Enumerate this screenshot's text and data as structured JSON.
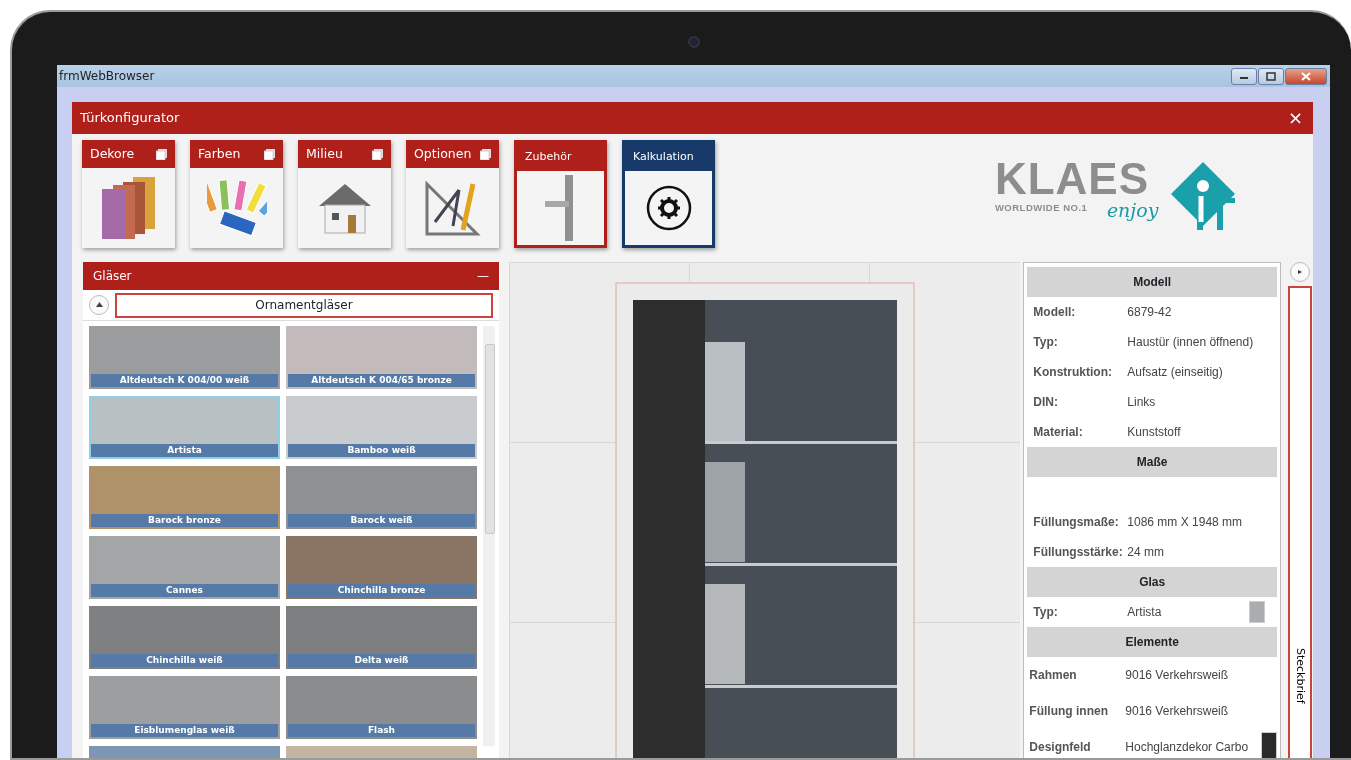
{
  "window": {
    "title": "frmWebBrowser"
  },
  "dialog": {
    "title": "Türkonfigurator",
    "close": "×"
  },
  "tiles": [
    {
      "label": "Dekore",
      "kind": "module",
      "has_menu": true,
      "selected": false
    },
    {
      "label": "Farben",
      "kind": "module",
      "has_menu": true,
      "selected": false
    },
    {
      "label": "Milieu",
      "kind": "module",
      "has_menu": true,
      "selected": false
    },
    {
      "label": "Optionen",
      "kind": "module",
      "has_menu": true,
      "selected": false
    },
    {
      "label": "Zubehör",
      "kind": "module",
      "has_menu": false,
      "selected": true
    },
    {
      "label": "Kalkulation",
      "kind": "calculation",
      "has_menu": false,
      "selected": false
    }
  ],
  "logo": {
    "name": "KLAES",
    "tagline": "WORLDWIDE NO.1",
    "slogan": "enjoy"
  },
  "glass_panel": {
    "title": "Gläser",
    "collapse": "—",
    "category": "Ornamentgläser",
    "items": [
      {
        "label": "Altdeutsch K 004/00 weiß",
        "color": "#9a9c9e",
        "selected": false
      },
      {
        "label": "Altdeutsch K 004/65 bronze",
        "color": "#c2babb",
        "selected": false
      },
      {
        "label": "Artista",
        "color": "#b9c0c4",
        "selected": true
      },
      {
        "label": "Bamboo weiß",
        "color": "#c8cccf",
        "selected": false
      },
      {
        "label": "Barock bronze",
        "color": "#b0926a",
        "selected": false
      },
      {
        "label": "Barock weiß",
        "color": "#8e9092",
        "selected": false
      },
      {
        "label": "Cannes",
        "color": "#a3a5a7",
        "selected": false
      },
      {
        "label": "Chinchilla bronze",
        "color": "#8a7464",
        "selected": false
      },
      {
        "label": "Chinchilla weiß",
        "color": "#7e8082",
        "selected": false
      },
      {
        "label": "Delta weiß",
        "color": "#7c7e80",
        "selected": false
      },
      {
        "label": "Eisblumenglas weiß",
        "color": "#9c9ea0",
        "selected": false
      },
      {
        "label": "Flash",
        "color": "#8a8c8e",
        "selected": false
      },
      {
        "color": "#7d96b4",
        "selected": false
      },
      {
        "color": "#c4b5a2",
        "selected": false
      }
    ]
  },
  "info_panel": {
    "tab": "Steckbrief",
    "expand": "▸",
    "rows": [
      {
        "kind": "header",
        "label": "Modell"
      },
      {
        "kind": "field",
        "label": "Modell:",
        "value": "6879-42"
      },
      {
        "kind": "field",
        "label": "Typ:",
        "value": "Haustür (innen öffnend)"
      },
      {
        "kind": "field",
        "label": "Konstruktion:",
        "value": "Aufsatz (einseitig)"
      },
      {
        "kind": "field",
        "label": "DIN:",
        "value": "Links"
      },
      {
        "kind": "field",
        "label": "Material:",
        "value": "Kunststoff"
      },
      {
        "kind": "header",
        "label": "Maße"
      },
      {
        "kind": "spacer"
      },
      {
        "kind": "field",
        "label": "Füllungsmaße:",
        "value": "1086 mm X 1948 mm"
      },
      {
        "kind": "field",
        "label": "Füllungsstärke:",
        "value": "24 mm"
      },
      {
        "kind": "header",
        "label": "Glas"
      },
      {
        "kind": "field",
        "label": "Typ:",
        "value": "Artista",
        "color": "#a9adb0"
      },
      {
        "kind": "header",
        "label": "Elemente"
      },
      {
        "kind": "element",
        "label": "Rahmen",
        "value": "9016 Verkehrsweiß"
      },
      {
        "kind": "element",
        "label": "Füllung innen",
        "value": "9016 Verkehrsweiß"
      },
      {
        "kind": "element",
        "label": "Designfeld",
        "value": "Hochglanzdekor Carbo",
        "color": "#2a2a2a"
      }
    ]
  }
}
